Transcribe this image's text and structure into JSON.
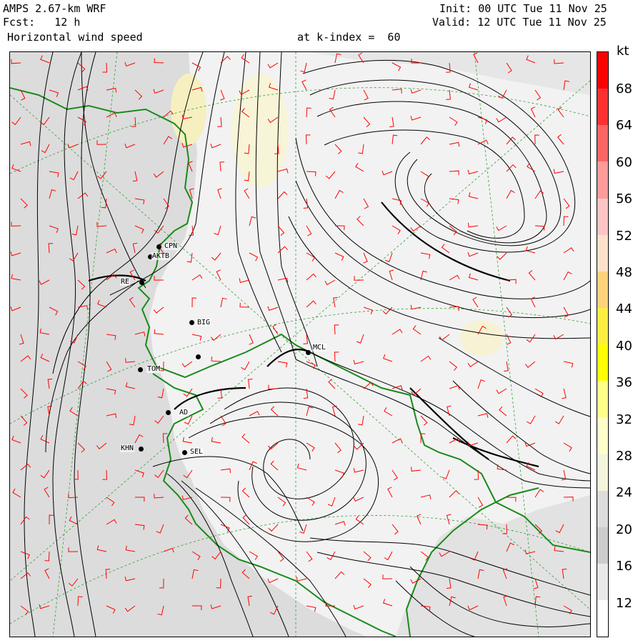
{
  "header": {
    "model": "AMPS 2.67-km WRF",
    "forecast_label": "Fcst:",
    "forecast_hours": "12 h",
    "field": "Horizontal wind speed",
    "level": "at k-index =  60",
    "init_label": "Init:",
    "init_time": "00 UTC Tue 11 Nov 25",
    "valid_label": "Valid:",
    "valid_time": "12 UTC Tue 11 Nov 25"
  },
  "colorbar": {
    "unit": "kt",
    "ticks": [
      "68",
      "64",
      "60",
      "56",
      "52",
      "48",
      "44",
      "40",
      "36",
      "32",
      "28",
      "24",
      "20",
      "16",
      "12"
    ],
    "colors": [
      "#ff0000",
      "#ff3030",
      "#ff6464",
      "#ff9a9a",
      "#ffc4c4",
      "#ffe0c8",
      "#ffd27a",
      "#ffee40",
      "#ffff00",
      "#ffff88",
      "#ffffc8",
      "#f4f4dc",
      "#dcdcdc",
      "#cccccc",
      "#e8e8e8",
      "#ffffff"
    ]
  },
  "stations": [
    {
      "label": "CPN"
    },
    {
      "label": "AKTB"
    },
    {
      "label": "RE"
    },
    {
      "label": "BIG"
    },
    {
      "label": "MCL"
    },
    {
      "label": "TOM"
    },
    {
      "label": "AD"
    },
    {
      "label": "KHN"
    },
    {
      "label": "SEL"
    }
  ],
  "colors": {
    "streamline": "#000000",
    "barb": "#ff0000",
    "coast": "#1a8a1a",
    "grid": "#2e9e2e",
    "land": "#d9d9d9",
    "sea": "#f0f0f0"
  }
}
